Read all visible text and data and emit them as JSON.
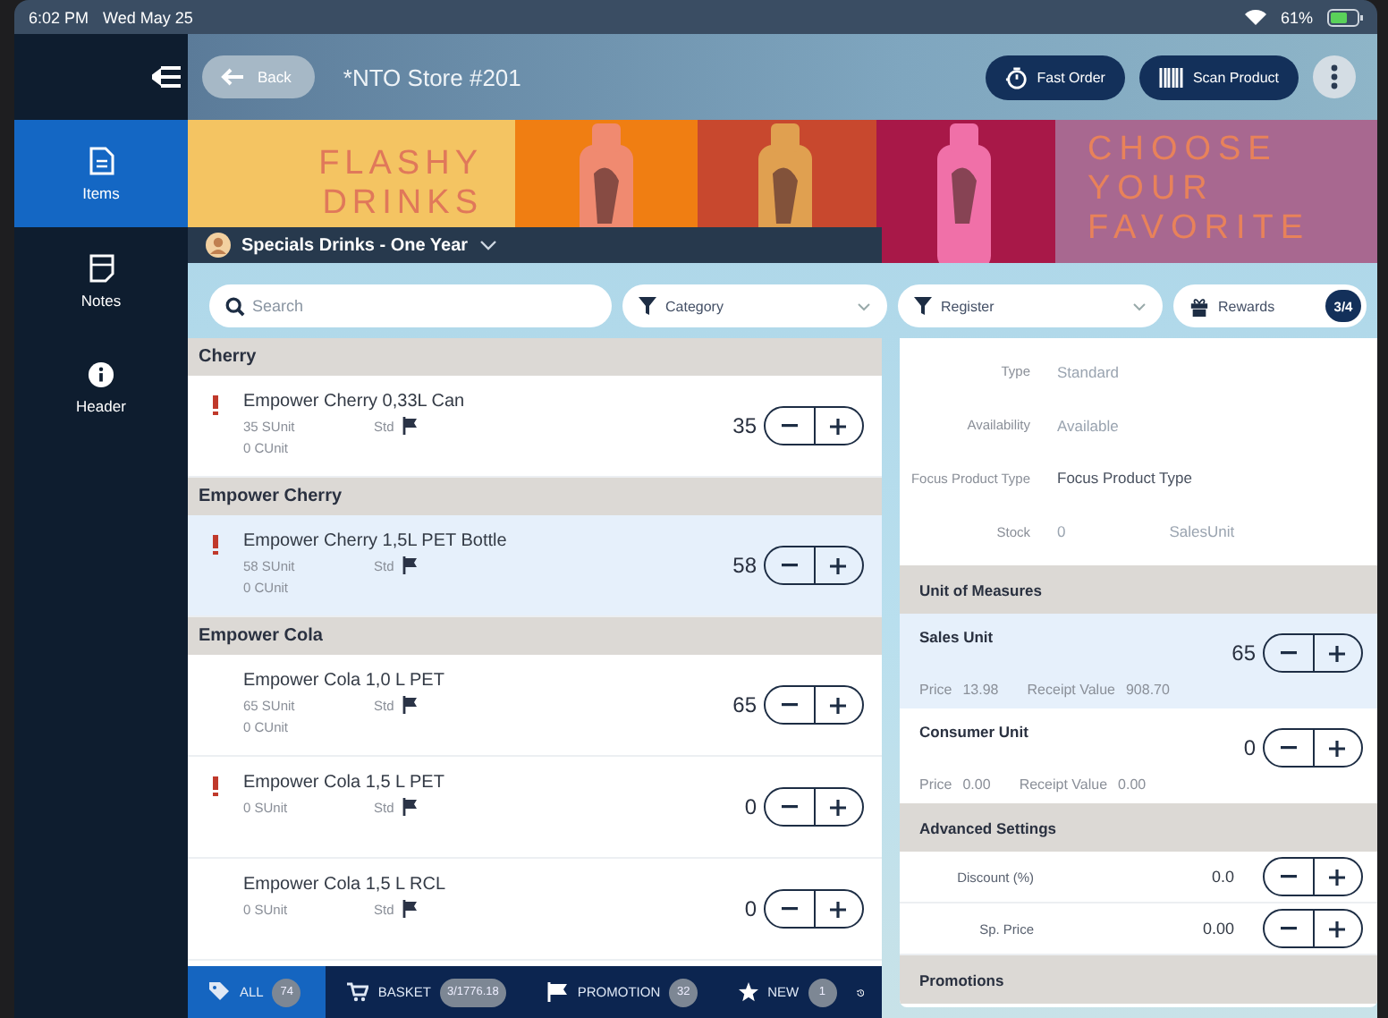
{
  "status_bar": {
    "time": "6:02 PM",
    "date": "Wed May 25",
    "battery": "61%"
  },
  "sidebar": {
    "items": [
      {
        "label": "Items",
        "selected": true
      },
      {
        "label": "Notes",
        "selected": false
      },
      {
        "label": "Header",
        "selected": false
      }
    ]
  },
  "top_bar": {
    "back": "Back",
    "title": "*NTO Store #201",
    "buttons": [
      "Fast Order",
      "Scan Product"
    ]
  },
  "banner": {
    "left_text": [
      "FLASHY",
      "DRINKS"
    ],
    "right_text": [
      "CHOOSE",
      "YOUR",
      "FAVORITE"
    ],
    "campaign": "Specials Drinks - One Year"
  },
  "filters": {
    "search": {
      "placeholder": "Search"
    },
    "category": "Category",
    "register": "Register",
    "rewards": {
      "label": "Rewards",
      "badge": "3/4"
    }
  },
  "groups": [
    {
      "title": "Cherry",
      "items": [
        {
          "name": "Empower Cherry 0,33L Can",
          "sunit": "35 SUnit",
          "std": "Std",
          "cunit": "0 CUnit",
          "qty": "35",
          "alert": true,
          "selected": false
        }
      ]
    },
    {
      "title": "Empower Cherry",
      "items": [
        {
          "name": "Empower Cherry 1,5L PET Bottle",
          "sunit": "58 SUnit",
          "std": "Std",
          "cunit": "0 CUnit",
          "qty": "58",
          "alert": true,
          "selected": true
        }
      ]
    },
    {
      "title": "Empower Cola",
      "items": [
        {
          "name": "Empower Cola 1,0 L PET",
          "sunit": "65 SUnit",
          "std": "Std",
          "cunit": "0 CUnit",
          "qty": "65",
          "alert": false,
          "selected": false
        },
        {
          "name": "Empower Cola 1,5 L PET",
          "sunit": "0 SUnit",
          "std": "Std",
          "qty": "0",
          "alert": true,
          "selected": false
        },
        {
          "name": "Empower Cola 1,5 L RCL",
          "sunit": "0 SUnit",
          "std": "Std",
          "qty": "0",
          "alert": false,
          "selected": false
        }
      ]
    }
  ],
  "bottom_nav": [
    {
      "label": "ALL",
      "badge": "74",
      "selected": true
    },
    {
      "label": "BASKET",
      "badge": "3/1776.18",
      "selected": false
    },
    {
      "label": "PROMOTION",
      "badge": "32",
      "selected": false
    },
    {
      "label": "NEW",
      "badge": "1",
      "selected": false
    }
  ],
  "details": [
    {
      "label": "Type",
      "value": "Standard"
    },
    {
      "label": "Availability",
      "value": "Available"
    },
    {
      "label": "Focus Product Type",
      "value": "Focus Product Type"
    },
    {
      "label": "Stock",
      "value": "0",
      "extra": "SalesUnit"
    }
  ],
  "unit_of_measures": {
    "title": "Unit of Measures",
    "units": [
      {
        "name": "Sales Unit",
        "qty": "65",
        "price_label": "Price",
        "price": "13.98",
        "receipt_label": "Receipt Value",
        "receipt": "908.70",
        "selected": true
      },
      {
        "name": "Consumer Unit",
        "qty": "0",
        "price_label": "Price",
        "price": "0.00",
        "receipt_label": "Receipt Value",
        "receipt": "0.00",
        "selected": false
      }
    ]
  },
  "advanced_settings": {
    "title": "Advanced Settings",
    "settings": [
      {
        "label": "Discount (%)",
        "value": "0.0"
      },
      {
        "label": "Sp. Price",
        "value": "0.00"
      }
    ]
  },
  "promotions": {
    "title": "Promotions"
  }
}
